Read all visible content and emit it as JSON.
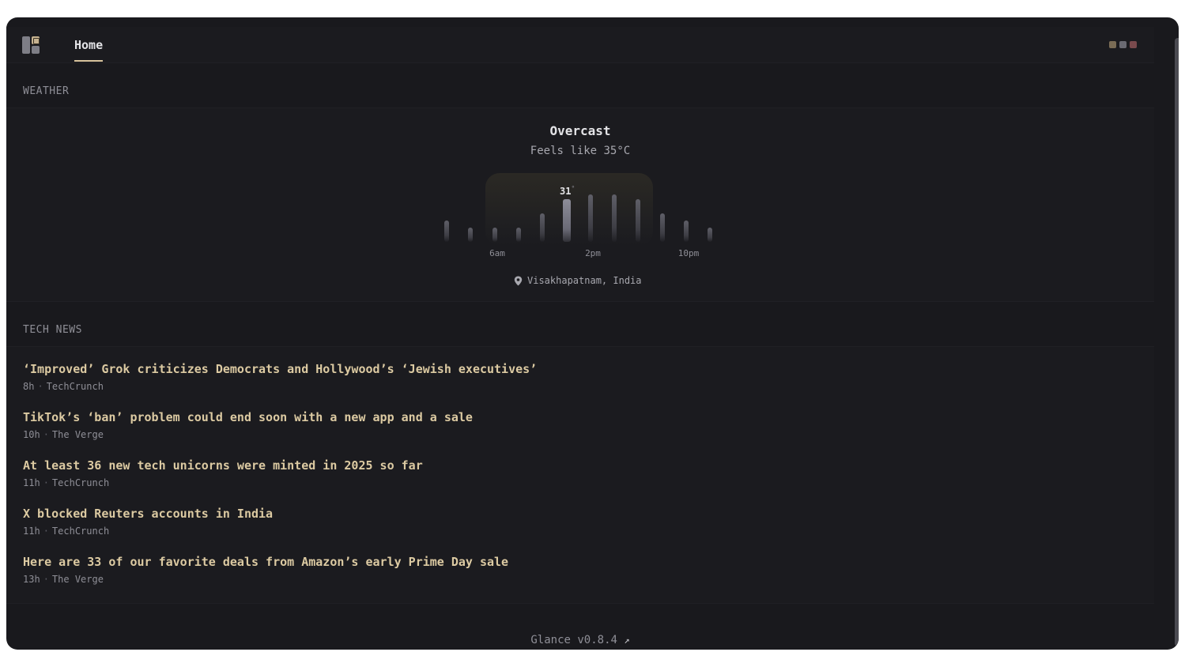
{
  "header": {
    "tab_home": "Home",
    "window_dot_colors": [
      "#7a6c55",
      "#6a6a72",
      "#7a4a4d"
    ],
    "accent": "#d7c39c"
  },
  "weather": {
    "section_title": "WEATHER",
    "condition": "Overcast",
    "feels_like": "Feels like 35°C",
    "current_temp": "31",
    "current_temp_unit": "°",
    "hour_labels": [
      "6am",
      "2pm",
      "10pm"
    ],
    "location": "Visakhapatnam, India",
    "location_icon": "map-pin-icon",
    "hourly_levels": [
      0.45,
      0.3,
      0.3,
      0.3,
      0.6,
      0.9,
      1.0,
      1.0,
      0.9,
      0.6,
      0.45,
      0.3
    ]
  },
  "news": {
    "section_title": "TECH NEWS",
    "items": [
      {
        "title": "‘Improved’ Grok criticizes Democrats and Hollywood’s ‘Jewish executives’",
        "age": "8h",
        "source": "TechCrunch"
      },
      {
        "title": "TikTok’s ‘ban’ problem could end soon with a new app and a sale",
        "age": "10h",
        "source": "The Verge"
      },
      {
        "title": "At least 36 new tech unicorns were minted in 2025 so far",
        "age": "11h",
        "source": "TechCrunch"
      },
      {
        "title": "X blocked Reuters accounts in India",
        "age": "11h",
        "source": "TechCrunch"
      },
      {
        "title": "Here are 33 of our favorite deals from Amazon’s early Prime Day sale",
        "age": "13h",
        "source": "The Verge"
      }
    ]
  },
  "footer": {
    "version": "Glance v0.8.4",
    "link_icon": "external-link-arrow-icon",
    "arrow": "↗"
  }
}
